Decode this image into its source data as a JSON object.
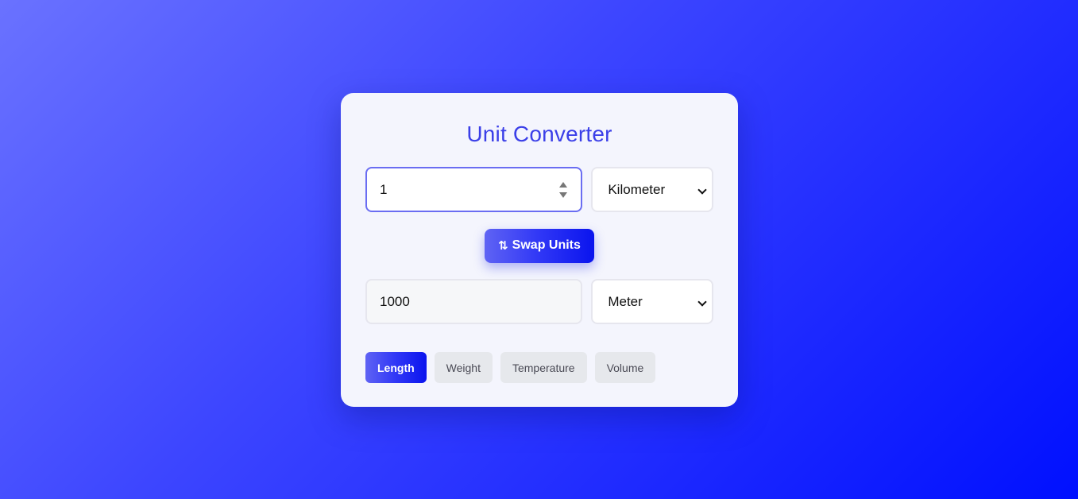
{
  "app": {
    "title": "Unit Converter"
  },
  "converter": {
    "input_value": "1",
    "from_unit": "Kilometer",
    "result_value": "1000",
    "to_unit": "Meter",
    "swap_icon": "⇅",
    "swap_label": "Swap Units"
  },
  "tabs": [
    {
      "label": "Length",
      "active": true
    },
    {
      "label": "Weight",
      "active": false
    },
    {
      "label": "Temperature",
      "active": false
    },
    {
      "label": "Volume",
      "active": false
    }
  ],
  "colors": {
    "accent": "#3b3fe8",
    "button_gradient_start": "#5f63f4",
    "button_gradient_end": "#0a14ee",
    "card_background": "#f4f5fd"
  },
  "icons": {
    "swap": "swap-vertical-arrows-icon",
    "spinner": "number-spinner-icon",
    "dropdown": "chevron-down-icon"
  }
}
